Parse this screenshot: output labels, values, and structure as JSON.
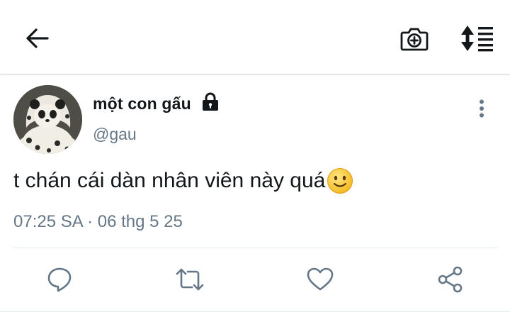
{
  "header": {
    "back_icon": "arrow-left-icon",
    "camera_icon": "camera-add-icon",
    "sort_icon": "sort-list-icon"
  },
  "tweet": {
    "display_name": "một con gấu",
    "handle": "@gau",
    "protected": true,
    "text": "t chán cái dàn nhân viên này quá",
    "emoji": "🙂",
    "timestamp": "07:25 SA · 06 thg 5 25"
  },
  "actions": {
    "reply_icon": "reply-icon",
    "retweet_icon": "retweet-icon",
    "like_icon": "heart-icon",
    "share_icon": "share-icon"
  },
  "colors": {
    "text": "#14171a",
    "secondary": "#657786",
    "icon": "#657786",
    "divider": "#e1e8ed"
  }
}
